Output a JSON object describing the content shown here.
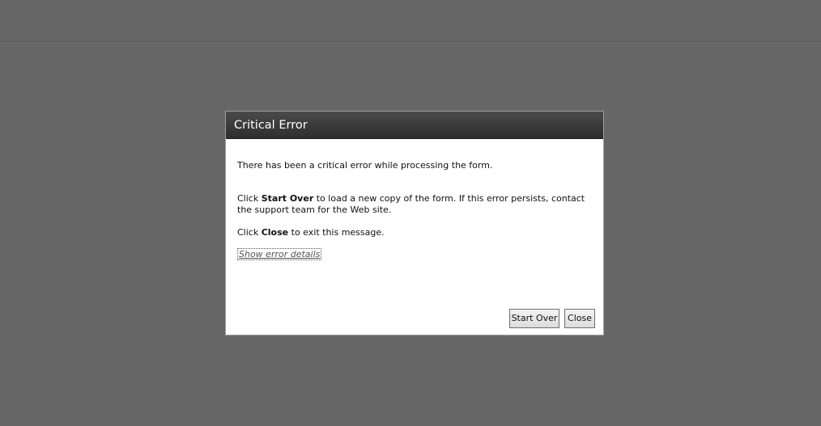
{
  "dialog": {
    "title": "Critical Error",
    "message_1": "There has been a critical error while processing the form.",
    "message_2": {
      "prefix": "Click ",
      "bold": "Start Over",
      "suffix": " to load a new copy of the form. If this error persists, contact the support team for the Web site."
    },
    "message_3": {
      "prefix": "Click ",
      "bold": "Close",
      "suffix": " to exit this message."
    },
    "details_link": "Show error details",
    "start_over_label": "Start Over",
    "close_label": "Close"
  }
}
